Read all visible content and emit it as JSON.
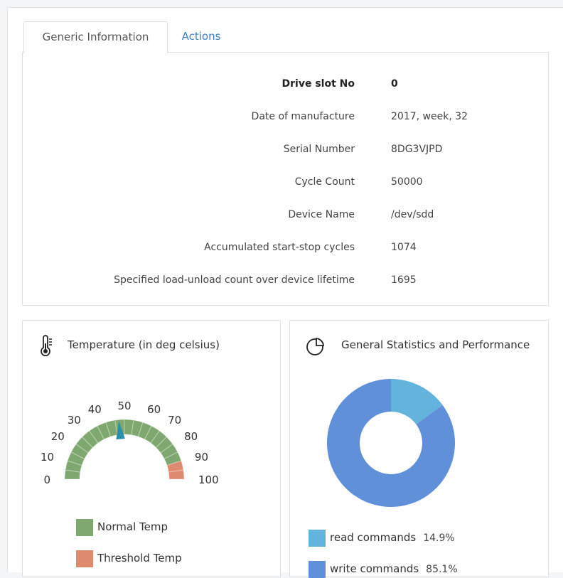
{
  "tabs": [
    {
      "label": "Generic Information",
      "active": true
    },
    {
      "label": "Actions",
      "active": false
    }
  ],
  "info_rows": [
    {
      "label": "Drive slot No",
      "value": "0",
      "bold": true
    },
    {
      "label": "Date of manufacture",
      "value": "2017, week, 32"
    },
    {
      "label": "Serial Number",
      "value": "8DG3VJPD"
    },
    {
      "label": "Cycle Count",
      "value": "50000"
    },
    {
      "label": "Device Name",
      "value": "/dev/sdd"
    },
    {
      "label": "Accumulated start-stop cycles",
      "value": "1074"
    },
    {
      "label": "Specified load-unload count over device lifetime",
      "value": "1695"
    }
  ],
  "temperature_card": {
    "title": "Temperature (in deg celsius)",
    "icon": "thermometer-icon"
  },
  "gauge": {
    "min": 0,
    "max": 100,
    "ticks": [
      "0",
      "10",
      "20",
      "30",
      "40",
      "50",
      "60",
      "70",
      "80",
      "90",
      "100"
    ],
    "threshold_start": 90,
    "value": 47,
    "normal_color": "#7fa870",
    "threshold_color": "#de8a6e",
    "needle_color": "#2a8fa8",
    "legend": [
      {
        "label": "Normal Temp",
        "color": "#7fa870"
      },
      {
        "label": "Threshold Temp",
        "color": "#de8a6e"
      }
    ]
  },
  "stats_card": {
    "title": "General Statistics and Performance",
    "icon": "pie-chart-icon"
  },
  "chart_data": {
    "type": "pie",
    "slices": [
      {
        "name": "read commands",
        "value": 14.9,
        "label": "14.9%",
        "color": "#62b4dc"
      },
      {
        "name": "write commands",
        "value": 85.1,
        "label": "85.1%",
        "color": "#6090da"
      }
    ]
  }
}
